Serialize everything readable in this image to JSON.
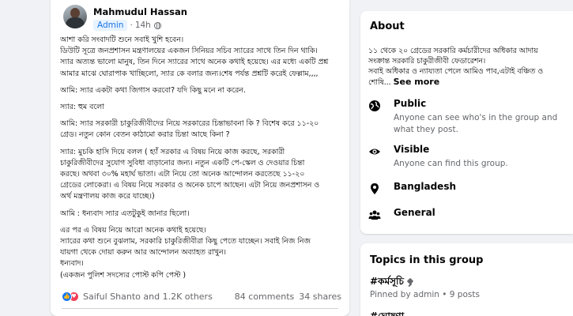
{
  "post": {
    "author": "Mahmudul Hassan",
    "badge": "Admin",
    "separator": "·",
    "time": "14h",
    "paragraphs": [
      [
        "আশা করি  সংবাদটি শুনে সবাই খুশি হবেন।",
        "ডিউটি সূত্রে জনপ্রশাসন মন্ত্রণালয়ের একজন সিনিয়র সচিব স্যারের সাথে তিন দিন থাকি।",
        "স্যার অত্যন্ত ভালো মানুষ, তিন দিনে স্যারের সাথে অনেক কথাই হয়েছে। এর মধ্যে একটি প্রশ্ন",
        "আমার মাঝে ঘোরাপাক খাচ্ছিলো, স্যার কে বলার জন্য।শেষ পর্যন্ত প্রশ্নটি করেই ফেল্লাম,,,,"
      ],
      [
        "আমি: স্যার একটা কথা জিগাস করবো? যদি কিছু মনে না করেন."
      ],
      [
        "স্যার:  হুম বলো"
      ],
      [
        "আমি: স্যার সরকারী চাকুরিজীবীদের নিয়ে সরকারের চিন্তাভাবনা কি ? বিশেষ করে ১১-২০",
        "গ্রেড। নতুন কোন বেতন কাঠামো করার চিন্তা আছে কিনা ?"
      ],
      [
        "স্যার:  মুচকি হাসি দিয়ে  বলল ( হ্যাঁ সরকার এ বিষয় নিয়ে কাজ করছে, সরকারী",
        "চাকুরিজীবীদের সুযোগ সুবিধা বাড়ানোর জন্য। নতুন একটি পে-স্কেল ও দেওয়ার চিন্তা",
        "করছে। অথবা ৩০% মহার্ঘ ভাতা। এটা নিয়ে তো অনেক আন্দোলন করতেছে ১১-২০",
        "গ্রেডের লোকেরা। এ বিষয় নিয়ে সরকার ও অনেক চাপে আছেন। এটা নিয়ে জনপ্রশাসন ও",
        "অর্থ মন্ত্রণালয়  কাজ করে যাচ্ছে।)"
      ],
      [
        "আমি :  ধন্যবাদ স্যার এতটুকুই জানার ছিলো।"
      ],
      [
        "এর পর এ বিষয় নিয়ে আরো অনেক কথাই হয়েছে।",
        "স্যারের কথা শুনে বুঝলাম, সরকারি চাকুরিজীবীরা কিছু পেতে যাচ্ছেন। সবাই নিজ নিজ",
        "যায়গা থেকে দোয়া করুন আর আন্দোলন অব্যাহত রাখুন।",
        "ধন্যবাদ।",
        "(একজন  পুলিশ  সদস্যের পোস্ট কপি পেস্ট )"
      ]
    ],
    "reactors": "Saiful Shanto and 1.2K others",
    "comments": "84 comments",
    "shares": "34 shares"
  },
  "about": {
    "title": "About",
    "description_lines": [
      "১১ থেকে ২০ গ্রেডের সরকারি কর্মচারীদের অধিকার আদায়",
      "সংক্রান্ত সরকারি চাকুরীজীবী ফেডারেশন।",
      "সবাই অধিকার ও ন্যায্যতা পেলে আমিও পাব,এটাই বঞ্চিত ও",
      "শোষি... "
    ],
    "see_more": "See more",
    "items": [
      {
        "icon": "globe-icon",
        "label": "Public",
        "sub": "Anyone can see who's in the group and what they post."
      },
      {
        "icon": "eye-icon",
        "label": "Visible",
        "sub": "Anyone can find this group."
      },
      {
        "icon": "location-pin-icon",
        "label": "Bangladesh",
        "sub": ""
      },
      {
        "icon": "group-icon",
        "label": "General",
        "sub": ""
      }
    ]
  },
  "topics": {
    "title": "Topics in this group",
    "topic_1": "#কর্মসূচি",
    "topic_1_meta": "Pinned by admin • 9 posts",
    "topic_2": "#ঘোষণা"
  },
  "colors": {
    "background": "#f0f2f5",
    "card": "#ffffff",
    "accent": "#1877f2",
    "love": "#f33e58",
    "secondary_text": "#65676b"
  }
}
